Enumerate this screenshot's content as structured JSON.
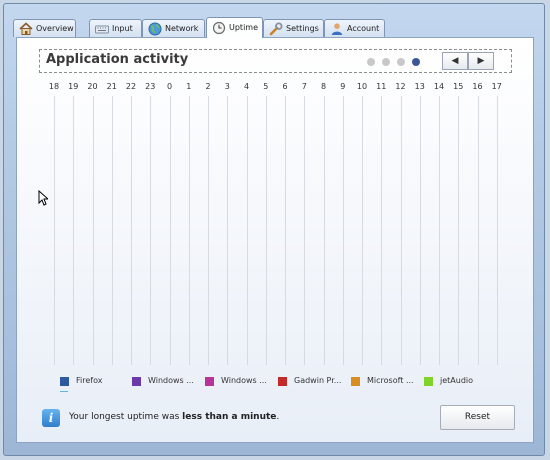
{
  "tabs": [
    {
      "label": "Overview",
      "icon": "home-icon"
    },
    {
      "label": "Input",
      "icon": "keyboard-icon"
    },
    {
      "label": "Network",
      "icon": "globe-icon"
    },
    {
      "label": "Uptime",
      "icon": "clock-icon",
      "active": true
    },
    {
      "label": "Settings",
      "icon": "wrench-icon"
    },
    {
      "label": "Account",
      "icon": "user-icon"
    }
  ],
  "panel": {
    "title": "Application activity",
    "page_dots": {
      "count": 4,
      "active_index": 3
    },
    "prev_label": "◀",
    "next_label": "▶"
  },
  "hours": [
    "18",
    "19",
    "20",
    "21",
    "22",
    "23",
    "0",
    "1",
    "2",
    "3",
    "4",
    "5",
    "6",
    "7",
    "8",
    "9",
    "10",
    "11",
    "12",
    "13",
    "14",
    "15",
    "16",
    "17"
  ],
  "legend": [
    {
      "label": "Firefox",
      "color": "#2e5a9e"
    },
    {
      "label": "Windows ...",
      "color": "#6a3aa8"
    },
    {
      "label": "Windows ...",
      "color": "#b8349a"
    },
    {
      "label": "Gadwin Pr...",
      "color": "#c42a2a"
    },
    {
      "label": "Microsoft ...",
      "color": "#d98e22"
    },
    {
      "label": "jetAudio",
      "color": "#7fd32a"
    }
  ],
  "status": {
    "prefix": "Your longest uptime was ",
    "emphasis": "less than a minute",
    "suffix": "."
  },
  "reset_label": "Reset"
}
